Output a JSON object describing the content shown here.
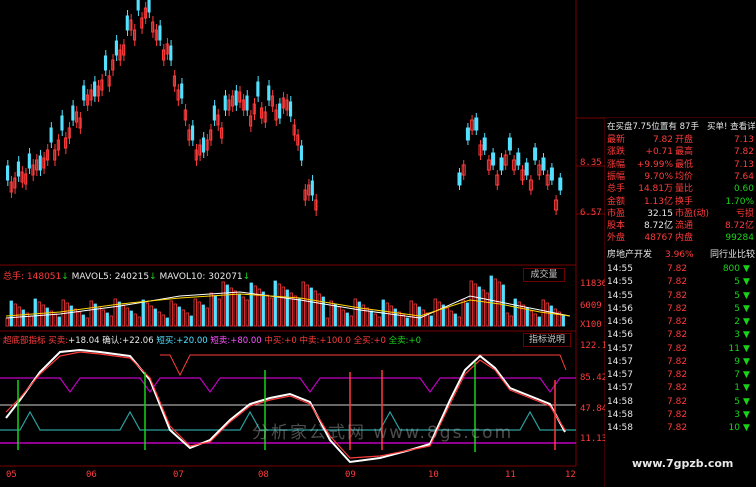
{
  "colors": {
    "up": "#ff3b3b",
    "down": "#54e0ff",
    "grid": "#7a0000",
    "text": "#c0c0c0",
    "white": "#ffffff",
    "yellow": "#ffd400",
    "magenta": "#c000c0",
    "teal": "#2aa0a0",
    "green": "#19d319"
  },
  "price_axis": {
    "top": "8.35",
    "bottom": "6.57"
  },
  "vol_bar": {
    "title": "总手: 148051",
    "mavol5": "MAVOL5: 240215",
    "mavol10": "MAVOL10: 302071",
    "dropdown": "成交量",
    "axis": [
      "11836",
      "6009",
      "X100"
    ]
  },
  "indicator": {
    "name": "超底部指标",
    "items": [
      {
        "label": "买卖:",
        "value": "+18.04"
      },
      {
        "label": "确认:",
        "value": "+22.06"
      },
      {
        "label": "短买:",
        "value": "+20.00"
      },
      {
        "label": "短卖:",
        "value": "+80.00"
      },
      {
        "label": "中买:",
        "value": "+0"
      },
      {
        "label": "中卖:",
        "value": "+100.0"
      },
      {
        "label": "全买:",
        "value": "+0"
      },
      {
        "label": "全卖:",
        "value": "+0"
      }
    ],
    "help": "指标说明",
    "axis": [
      "122.1",
      "85.42",
      "47.84",
      "11.13"
    ]
  },
  "x_axis": [
    "05",
    "06",
    "07",
    "08",
    "09",
    "10",
    "11",
    "12"
  ],
  "quote": {
    "header": "在买盘7.75位置有  87手",
    "buy1": "买单!",
    "detail": "查看详细",
    "rows": [
      [
        "最新",
        "7.82",
        "开盘",
        "7.13"
      ],
      [
        "涨跌",
        "+0.71",
        "最高",
        "7.82"
      ],
      [
        "涨幅",
        "+9.99%",
        "最低",
        "7.13"
      ],
      [
        "振幅",
        "9.70%",
        "均价",
        "7.64"
      ],
      [
        "总手",
        "14.81万",
        "量比",
        "0.60"
      ],
      [
        "金额",
        "1.13亿",
        "换手",
        "1.70%"
      ],
      [
        "市盈",
        "32.15",
        "市盈(动)",
        "亏损"
      ],
      [
        "股本",
        "8.72亿",
        "流通",
        "8.72亿"
      ],
      [
        "外盘",
        "48767",
        "内盘",
        "99284"
      ]
    ],
    "sector": "房地产开发",
    "sector_pct": "3.96%",
    "rank": "同行业比较"
  },
  "ticks": [
    {
      "t": "14:55",
      "p": "7.82",
      "v": "800"
    },
    {
      "t": "14:55",
      "p": "7.82",
      "v": "5"
    },
    {
      "t": "14:55",
      "p": "7.82",
      "v": "5"
    },
    {
      "t": "14:56",
      "p": "7.82",
      "v": "5"
    },
    {
      "t": "14:56",
      "p": "7.82",
      "v": "2"
    },
    {
      "t": "14:56",
      "p": "7.82",
      "v": "3"
    },
    {
      "t": "14:57",
      "p": "7.82",
      "v": "11"
    },
    {
      "t": "14:57",
      "p": "7.82",
      "v": "9"
    },
    {
      "t": "14:57",
      "p": "7.82",
      "v": "7"
    },
    {
      "t": "14:57",
      "p": "7.82",
      "v": "1"
    },
    {
      "t": "14:58",
      "p": "7.82",
      "v": "5"
    },
    {
      "t": "14:58",
      "p": "7.82",
      "v": "3"
    },
    {
      "t": "14:58",
      "p": "7.82",
      "v": "10"
    }
  ],
  "watermark": "www.7gpzb.com",
  "watermark2": "分析家公式网 www.8gs.com"
}
